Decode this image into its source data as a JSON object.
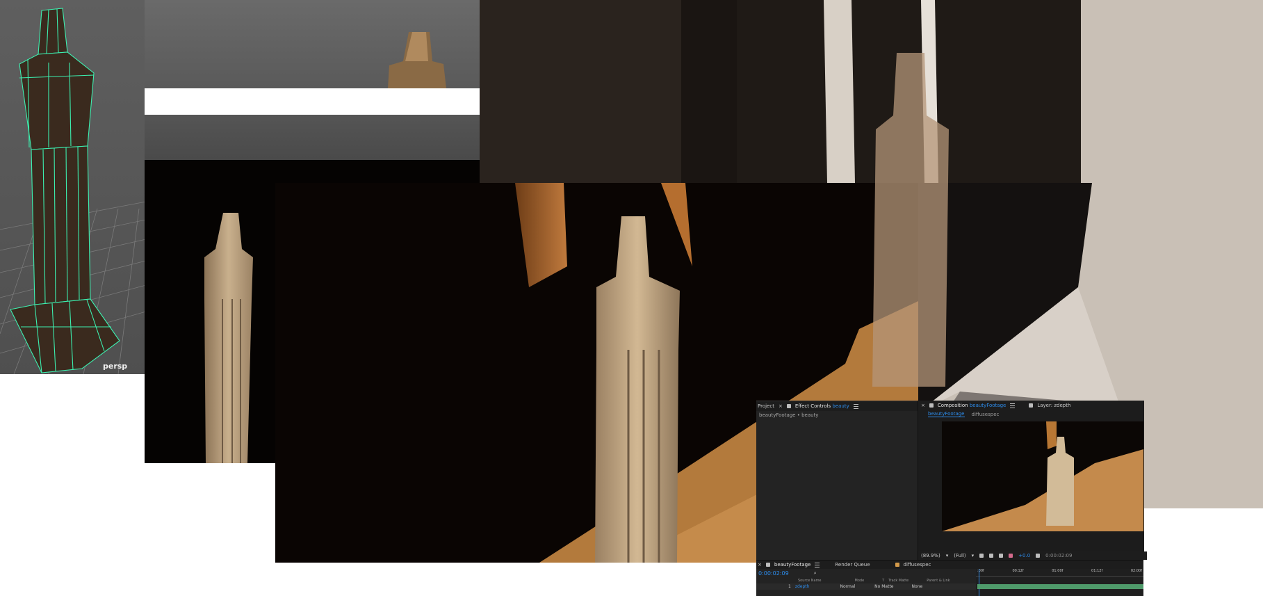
{
  "maya_viewport": {
    "camera_label": "persp"
  },
  "ae": {
    "effect_panel": {
      "project_tab": "Project",
      "effect_controls_label": "Effect Controls",
      "effect_controls_layer": "beauty",
      "breadcrumb": "beautyFootage • beauty"
    },
    "composition_panel": {
      "tab_label": "Composition",
      "comp_name": "beautyFootage",
      "layer_tab_label": "Layer:",
      "layer_tab_value": "zdepth",
      "subtab_active": "beautyFootage",
      "subtab_other": "diffusespec"
    },
    "comp_footer": {
      "zoom": "(89.9%)",
      "resolution": "(Full)",
      "exposure": "+0.0",
      "timecode": "0:00:02:09"
    },
    "timeline": {
      "tabs": [
        "beautyFootage",
        "Render Queue",
        "diffusespec"
      ],
      "current_time": "0:00:02:09",
      "ruler_marks": [
        ":00f",
        "00:12f",
        "01:00f",
        "01:12f",
        "02:00f"
      ],
      "columns": {
        "source_name": "Source Name",
        "mode": "Mode",
        "t": "T",
        "track_matte": "Track Matte",
        "parent": "Parent & Link"
      },
      "layer": {
        "index": "1",
        "name": "zdepth",
        "mode": "Normal",
        "track_matte": "No Matte",
        "parent": "None"
      }
    }
  }
}
